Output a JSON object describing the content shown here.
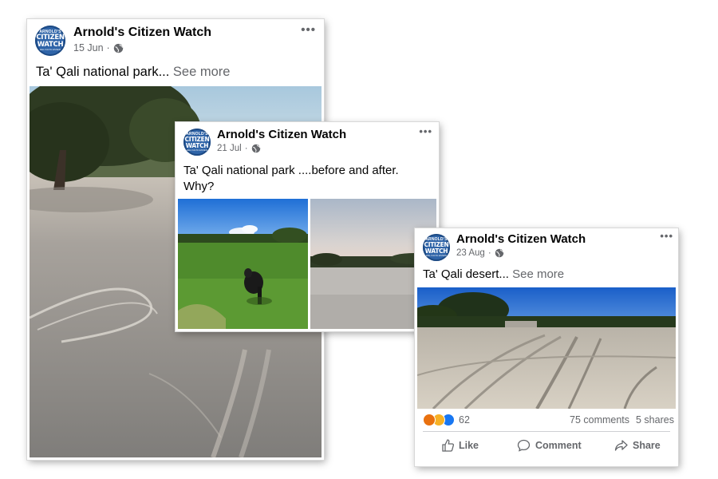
{
  "posts": [
    {
      "page_name": "Arnold's Citizen Watch",
      "avatar": {
        "top": "ARNOLD'S",
        "line1": "CITIZEN",
        "line2": "WATCH",
        "bottom": "EEL FALTA ESSER"
      },
      "date": "15 Jun",
      "separator": "·",
      "privacy_icon": "globe-icon",
      "text": "Ta' Qali national park...",
      "see_more": "See more",
      "menu_icon": "more-dots-icon"
    },
    {
      "page_name": "Arnold's Citizen Watch",
      "avatar": {
        "top": "ARNOLD'S",
        "line1": "CITIZEN",
        "line2": "WATCH",
        "bottom": "EEL FALTA ESSER"
      },
      "date": "21 Jul",
      "separator": "·",
      "privacy_icon": "globe-icon",
      "text_line1": "Ta' Qali national park ....before and after.",
      "text_line2": "Why?",
      "menu_icon": "more-dots-icon"
    },
    {
      "page_name": "Arnold's Citizen Watch",
      "avatar": {
        "top": "ARNOLD'S",
        "line1": "CITIZEN",
        "line2": "WATCH",
        "bottom": "EEL FALTA ESSER"
      },
      "date": "23 Aug",
      "separator": "·",
      "privacy_icon": "globe-icon",
      "text": "Ta' Qali desert...",
      "see_more": "See more",
      "menu_icon": "more-dots-icon",
      "reactions": {
        "icons": [
          "angry",
          "sad",
          "like"
        ],
        "count": "62"
      },
      "comments": "75 comments",
      "shares": "5 shares",
      "actions": [
        {
          "label": "Like",
          "icon": "thumbs-up-icon"
        },
        {
          "label": "Comment",
          "icon": "comment-bubble-icon"
        },
        {
          "label": "Share",
          "icon": "share-arrow-icon"
        }
      ]
    }
  ],
  "colors": {
    "facebook_blue": "#1877f2",
    "meta_gray": "#65676b",
    "avatar_blue": "#2f64a8",
    "angry": "#e9710f",
    "sad": "#f7b125"
  }
}
